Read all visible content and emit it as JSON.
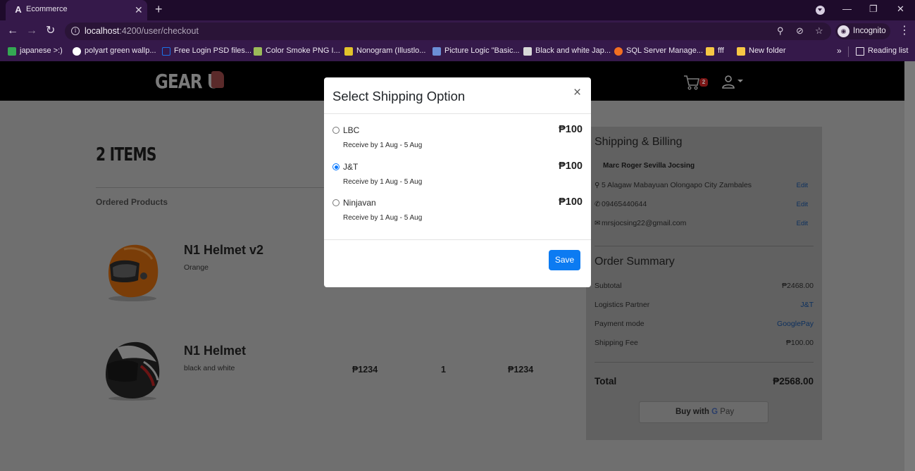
{
  "browser": {
    "tab_title": "Ecommerce",
    "tab_favicon": "A",
    "url_host": "localhost",
    "url_path": ":4200/user/checkout",
    "profile_label": "Incognito",
    "bookmarks": [
      {
        "label": "japanese >:)",
        "icon": "drive-icon",
        "color": "#34a853"
      },
      {
        "label": "polyart green wallp...",
        "icon": "google-icon",
        "color": "#ffffff"
      },
      {
        "label": "Free Login PSD files...",
        "icon": "square-icon",
        "color": "#1a73e8"
      },
      {
        "label": "Color Smoke PNG I...",
        "icon": "image-icon",
        "color": "#9bbb59"
      },
      {
        "label": "Nonogram (Illustlo...",
        "icon": "shield-icon",
        "color": "#e2c32b"
      },
      {
        "label": "Picture Logic \"Basic...",
        "icon": "picture-icon",
        "color": "#6b8fd6"
      },
      {
        "label": "Black and white Jap...",
        "icon": "building-icon",
        "color": "#d8d8d8"
      },
      {
        "label": "SQL Server Manage...",
        "icon": "sql-icon",
        "color": "#f26f21"
      },
      {
        "label": "fff",
        "icon": "folder-icon",
        "color": "#f6c744"
      },
      {
        "label": "New folder",
        "icon": "folder-icon",
        "color": "#f6c744"
      }
    ],
    "bookmarks_more": "»",
    "reading_list": "Reading list"
  },
  "site": {
    "logo_text": "GEAR U",
    "cart_count": "2"
  },
  "checkout": {
    "items_title": "2 ITEMS",
    "ordered_products_label": "Ordered Products",
    "products": [
      {
        "name": "N1 Helmet v2",
        "variant": "Orange",
        "price": "",
        "qty": "",
        "total": ""
      },
      {
        "name": "N1 Helmet",
        "variant": "black and white",
        "price": "₱1234",
        "qty": "1",
        "total": "₱1234"
      }
    ]
  },
  "summary": {
    "shipping_heading": "Shipping & Billing",
    "customer_name": "Marc Roger Sevilla Jocsing",
    "address": "5 Alagaw Mabayuan Olongapo City Zambales",
    "phone": "09465440644",
    "email": "mrsjocsing22@gmail.com",
    "edit_label": "Edit",
    "order_heading": "Order Summary",
    "rows": [
      {
        "label": "Subtotal",
        "value": "₱2468.00",
        "link": false
      },
      {
        "label": "Logistics Partner",
        "value": "J&T",
        "link": true
      },
      {
        "label": "Payment mode",
        "value": "GooglePay",
        "link": true
      },
      {
        "label": "Shipping Fee",
        "value": "₱100.00",
        "link": false
      }
    ],
    "total_label": "Total",
    "total_value": "₱2568.00",
    "buy_label": "Buy with",
    "gpay_g": "G",
    "gpay_pay": "Pay"
  },
  "modal": {
    "title": "Select Shipping Option",
    "close": "×",
    "options": [
      {
        "name": "LBC",
        "price": "₱100",
        "eta": "Receive by 1 Aug - 5 Aug",
        "checked": false
      },
      {
        "name": "J&T",
        "price": "₱100",
        "eta": "Receive by 1 Aug - 5 Aug",
        "checked": true
      },
      {
        "name": "Ninjavan",
        "price": "₱100",
        "eta": "Receive by 1 Aug - 5 Aug",
        "checked": false
      }
    ],
    "save_label": "Save"
  }
}
